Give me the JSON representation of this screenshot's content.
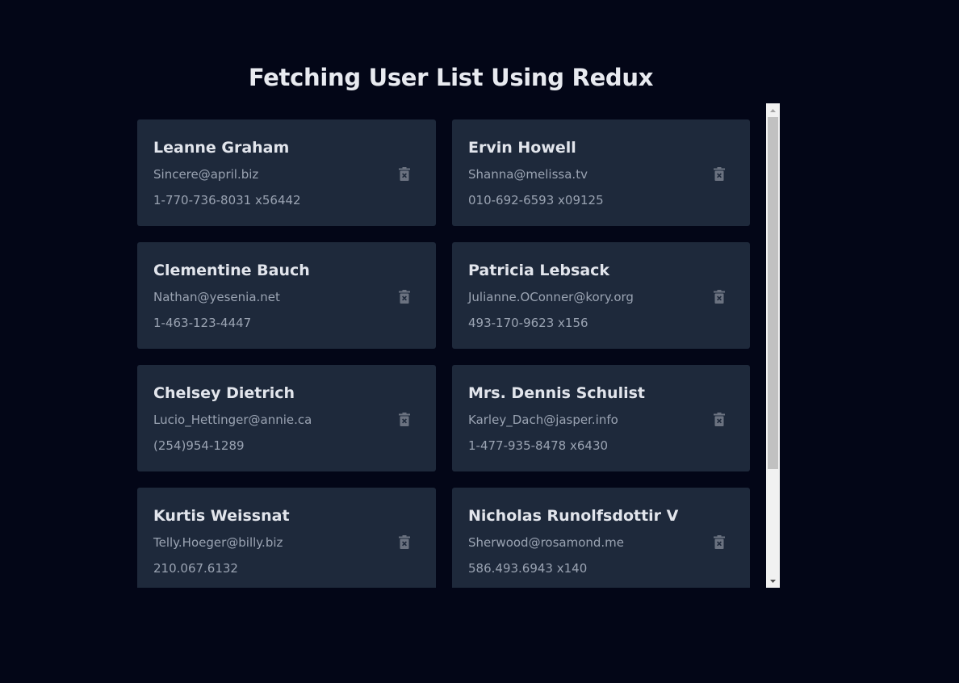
{
  "header": {
    "title": "Fetching User List Using Redux"
  },
  "colors": {
    "background": "#030617",
    "card": "#1e293b",
    "name_text": "#e2e5ec",
    "detail_text": "#9aa3b2",
    "delete_icon": "#6b7280"
  },
  "users": [
    {
      "name": "Leanne Graham",
      "email": "Sincere@april.biz",
      "phone": "1-770-736-8031 x56442",
      "action_icon": "trash-icon"
    },
    {
      "name": "Ervin Howell",
      "email": "Shanna@melissa.tv",
      "phone": "010-692-6593 x09125",
      "action_icon": "trash-icon"
    },
    {
      "name": "Clementine Bauch",
      "email": "Nathan@yesenia.net",
      "phone": "1-463-123-4447",
      "action_icon": "trash-icon"
    },
    {
      "name": "Patricia Lebsack",
      "email": "Julianne.OConner@kory.org",
      "phone": "493-170-9623 x156",
      "action_icon": "trash-icon"
    },
    {
      "name": "Chelsey Dietrich",
      "email": "Lucio_Hettinger@annie.ca",
      "phone": "(254)954-1289",
      "action_icon": "trash-icon"
    },
    {
      "name": "Mrs. Dennis Schulist",
      "email": "Karley_Dach@jasper.info",
      "phone": "1-477-935-8478 x6430",
      "action_icon": "trash-icon"
    },
    {
      "name": "Kurtis Weissnat",
      "email": "Telly.Hoeger@billy.biz",
      "phone": "210.067.6132",
      "action_icon": "trash-icon"
    },
    {
      "name": "Nicholas Runolfsdottir V",
      "email": "Sherwood@rosamond.me",
      "phone": "586.493.6943 x140",
      "action_icon": "trash-icon"
    }
  ]
}
